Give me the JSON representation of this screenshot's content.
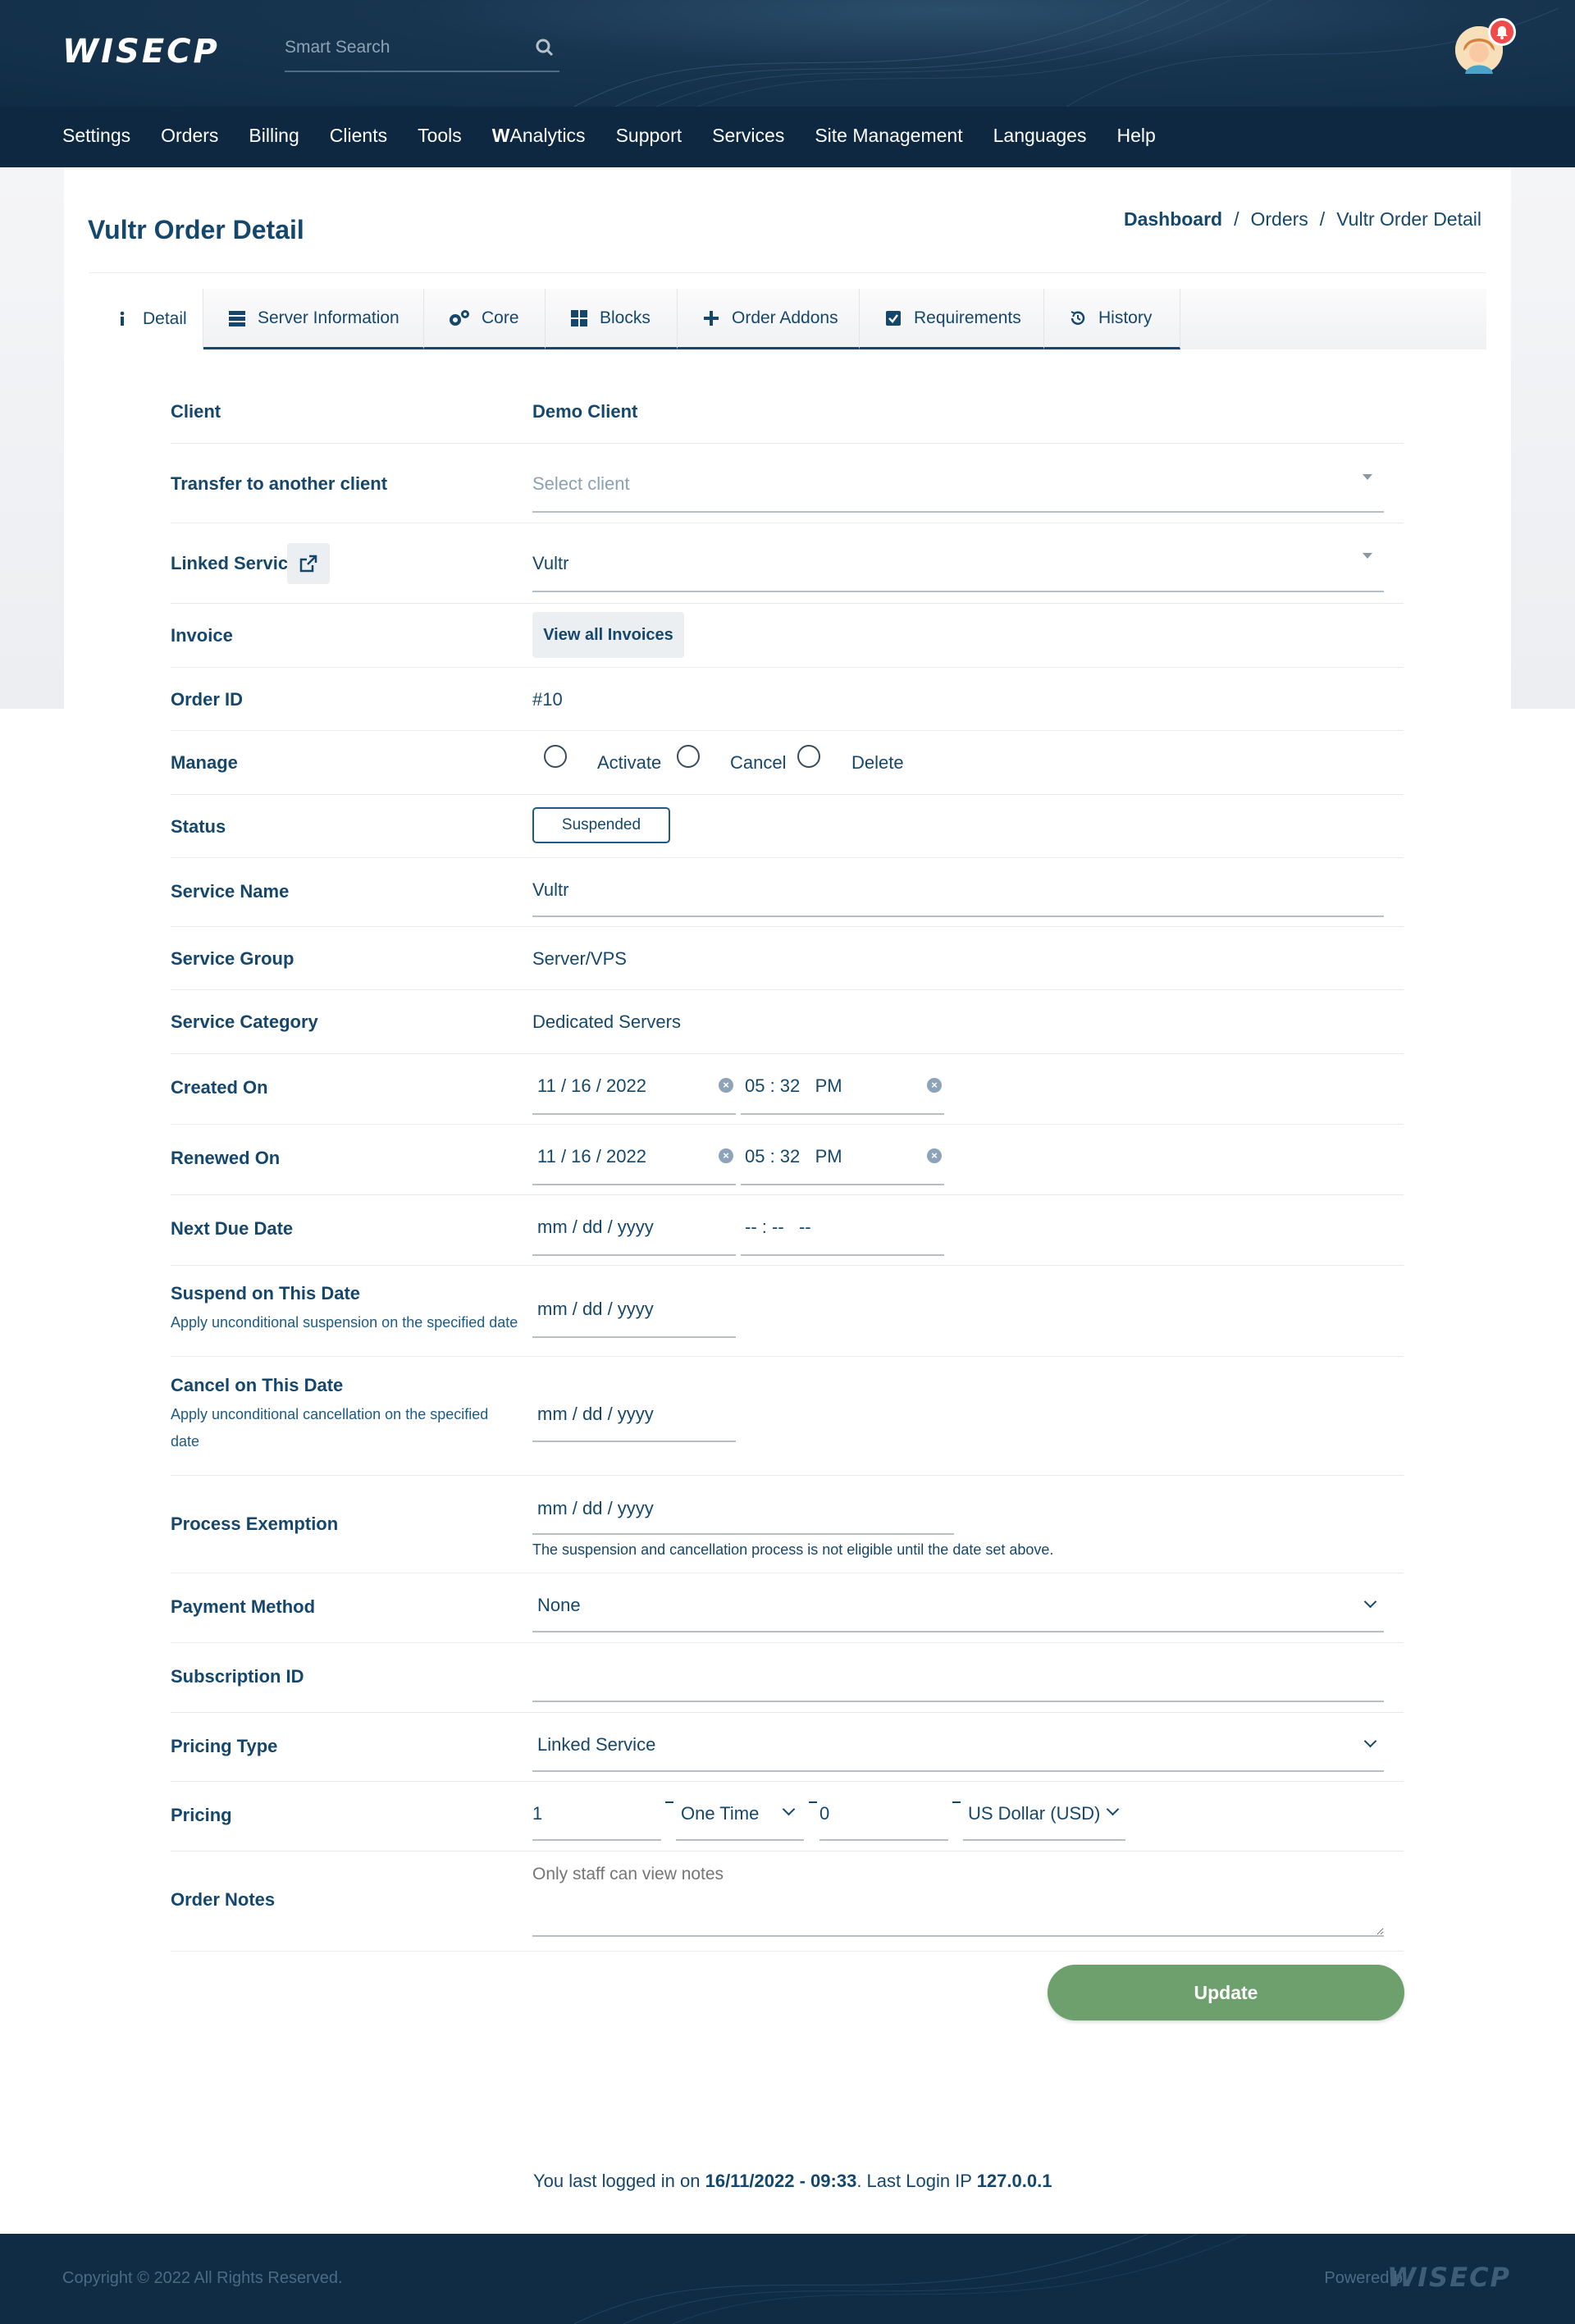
{
  "header": {
    "logo": "WISECP",
    "search_placeholder": "Smart Search"
  },
  "nav": {
    "items": [
      "Settings",
      "Orders",
      "Billing",
      "Clients",
      "Tools",
      "Analytics",
      "Support",
      "Services",
      "Site Management",
      "Languages",
      "Help"
    ],
    "analytics_prefix": "W"
  },
  "page": {
    "title": "Vultr Order Detail",
    "breadcrumb": [
      "Dashboard",
      "/",
      "Orders",
      "/",
      "Vultr Order Detail"
    ]
  },
  "tabs": [
    "Detail",
    "Server Information",
    "Core",
    "Blocks",
    "Order Addons",
    "Requirements",
    "History"
  ],
  "form": {
    "client": {
      "label": "Client",
      "value": "Demo Client"
    },
    "transfer": {
      "label": "Transfer to another client",
      "placeholder": "Select client"
    },
    "linked_service": {
      "label": "Linked Service",
      "value": "Vultr"
    },
    "invoice": {
      "label": "Invoice",
      "button": "View all Invoices"
    },
    "order_id": {
      "label": "Order ID",
      "value": "#10"
    },
    "manage": {
      "label": "Manage",
      "options": [
        "Activate",
        "Cancel",
        "Delete"
      ]
    },
    "status": {
      "label": "Status",
      "value": "Suspended"
    },
    "service_name": {
      "label": "Service Name",
      "value": "Vultr"
    },
    "service_group": {
      "label": "Service Group",
      "value": "Server/VPS"
    },
    "service_category": {
      "label": "Service Category",
      "value": "Dedicated Servers"
    },
    "created_on": {
      "label": "Created On",
      "date": "11 / 16 / 2022",
      "time": "05 : 32   PM"
    },
    "renewed_on": {
      "label": "Renewed On",
      "date": "11 / 16 / 2022",
      "time": "05 : 32   PM"
    },
    "next_due": {
      "label": "Next Due Date",
      "date": "mm / dd / yyyy",
      "time": "-- : --   --"
    },
    "suspend_date": {
      "label": "Suspend on This Date",
      "note": "Apply unconditional suspension on the specified date",
      "date": "mm / dd / yyyy"
    },
    "cancel_date": {
      "label": "Cancel on This Date",
      "note": "Apply unconditional cancellation on the specified date",
      "date": "mm / dd / yyyy"
    },
    "exemption": {
      "label": "Process Exemption",
      "date": "mm / dd / yyyy",
      "note": "The suspension and cancellation process is not eligible until the date set above."
    },
    "payment_method": {
      "label": "Payment Method",
      "value": "None"
    },
    "subscription_id": {
      "label": "Subscription ID",
      "value": ""
    },
    "pricing_type": {
      "label": "Pricing Type",
      "value": "Linked Service"
    },
    "pricing": {
      "label": "Pricing",
      "amount": "1",
      "period": "One Time",
      "setup": "0",
      "currency": "US Dollar (USD)"
    },
    "order_notes": {
      "label": "Order Notes",
      "placeholder": "Only staff can view notes"
    },
    "update_button": "Update"
  },
  "last_login": {
    "prefix": "You last logged in on",
    "datetime": "16/11/2022 - 09:33",
    "ip_label": ". Last Login IP",
    "ip": "127.0.0.1"
  },
  "footer": {
    "copyright": "Copyright © 2022 All Rights Reserved.",
    "powered": "Powered by",
    "logo": "WISECP"
  }
}
